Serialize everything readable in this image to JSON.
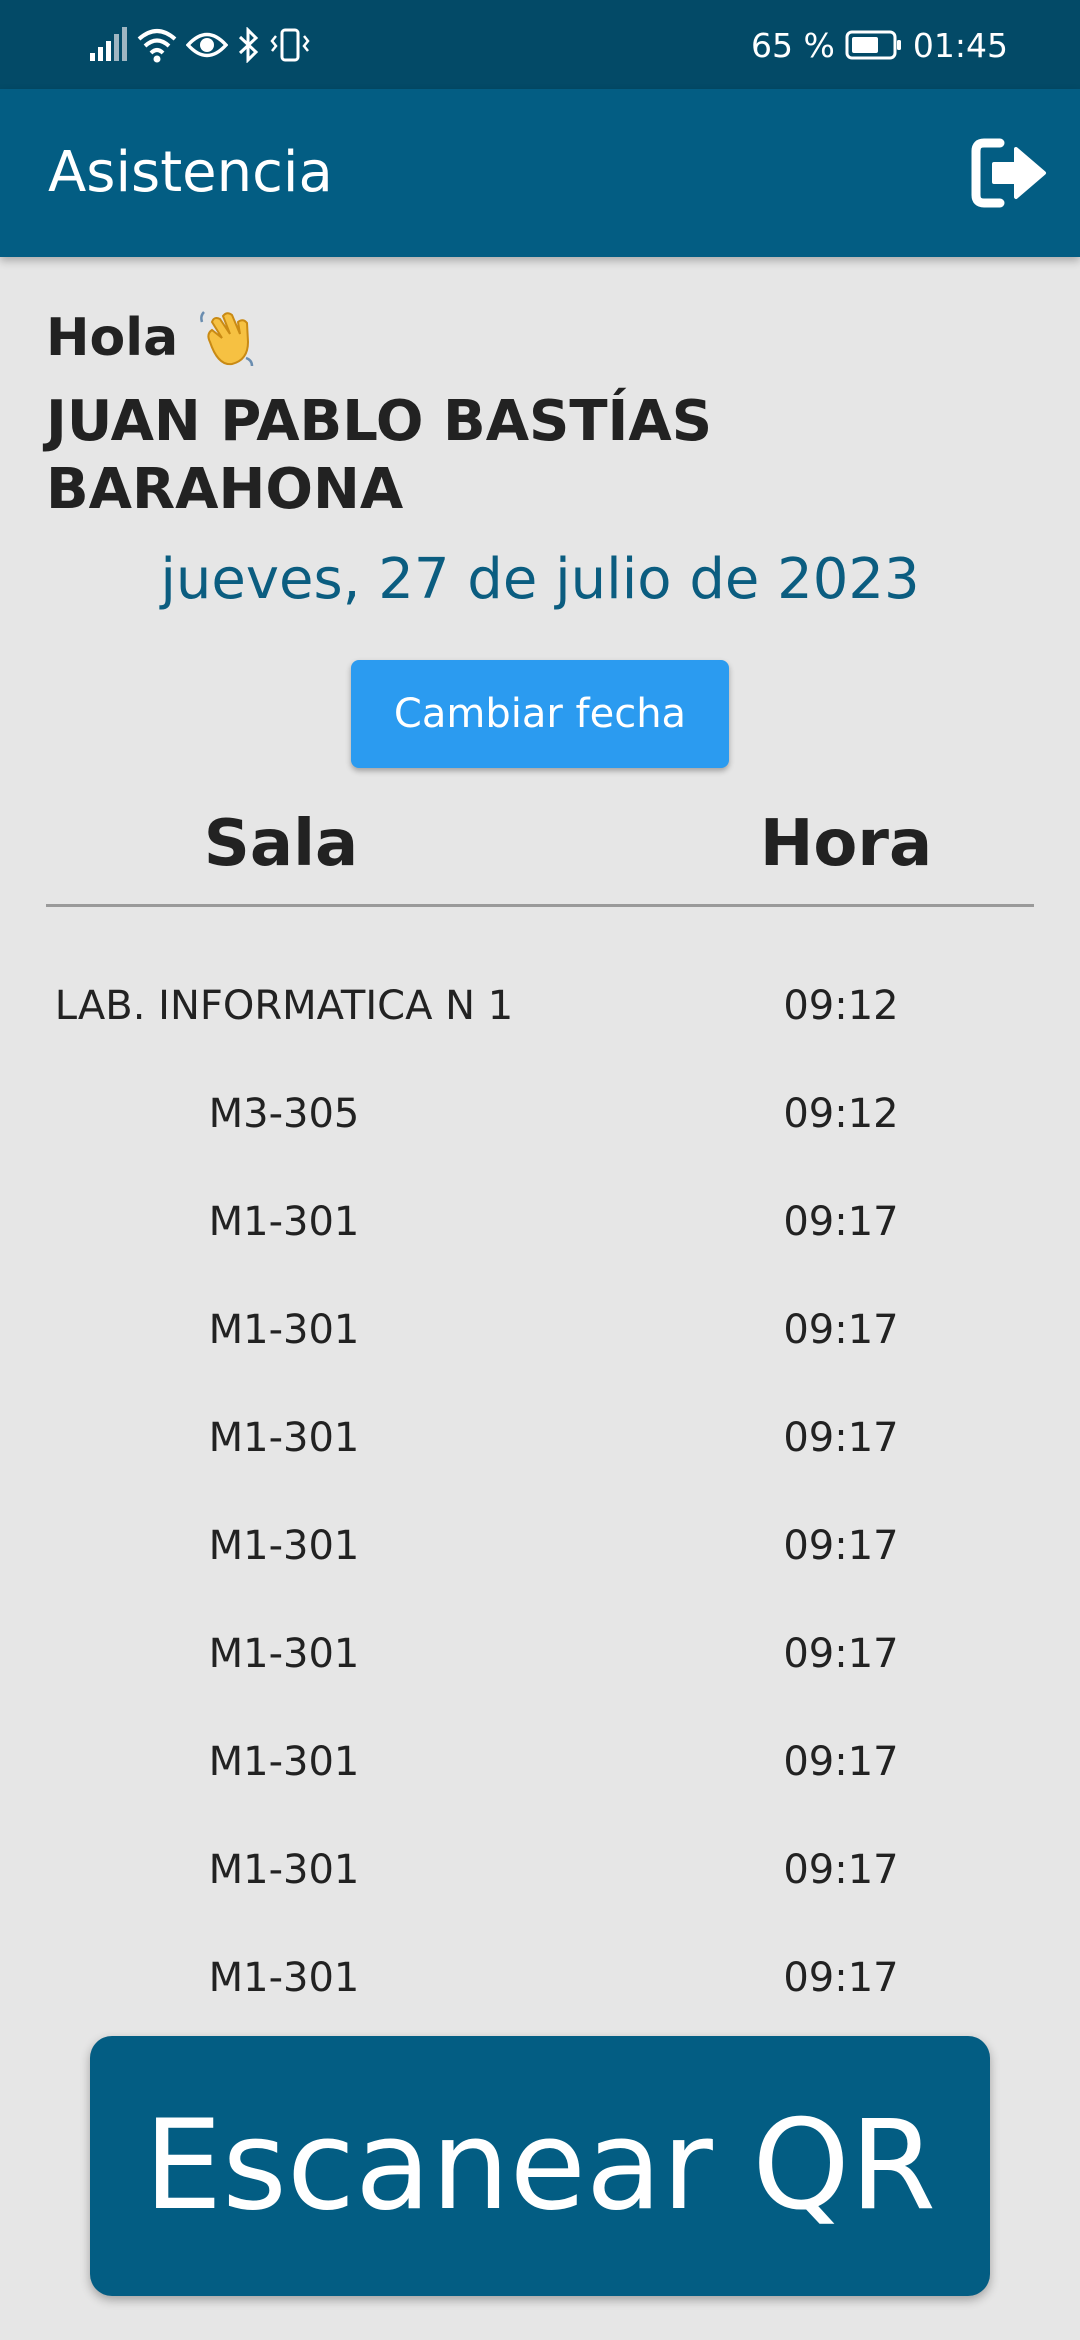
{
  "status_bar": {
    "battery": "65 %",
    "time": "01:45",
    "icons": [
      "signal-icon",
      "wifi-icon",
      "eye-icon",
      "bluetooth-icon",
      "vibrate-icon",
      "battery-icon"
    ]
  },
  "app_bar": {
    "title": "Asistencia",
    "logout_icon": "logout-icon"
  },
  "greeting": {
    "hello": "Hola",
    "emoji": "waving-hand-icon",
    "name": "JUAN PABLO BASTÍAS BARAHONA"
  },
  "date": "jueves, 27 de julio de 2023",
  "change_date_label": "Cambiar fecha",
  "table": {
    "headers": [
      "Sala",
      "Hora"
    ],
    "rows": [
      {
        "sala": "LAB. INFORMATICA N 1",
        "hora": "09:12"
      },
      {
        "sala": "M3-305",
        "hora": "09:12"
      },
      {
        "sala": "M1-301",
        "hora": "09:17"
      },
      {
        "sala": "M1-301",
        "hora": "09:17"
      },
      {
        "sala": "M1-301",
        "hora": "09:17"
      },
      {
        "sala": "M1-301",
        "hora": "09:17"
      },
      {
        "sala": "M1-301",
        "hora": "09:17"
      },
      {
        "sala": "M1-301",
        "hora": "09:17"
      },
      {
        "sala": "M1-301",
        "hora": "09:17"
      },
      {
        "sala": "M1-301",
        "hora": "09:17"
      }
    ]
  },
  "scan_button_label": "Escanear QR",
  "colors": {
    "status_bar": "#034a67",
    "app_bar": "#035d83",
    "background": "#e6e6e6",
    "date_text": "#0b5d80",
    "change_date_button": "#2b9bf0",
    "scan_button": "#035d83"
  }
}
